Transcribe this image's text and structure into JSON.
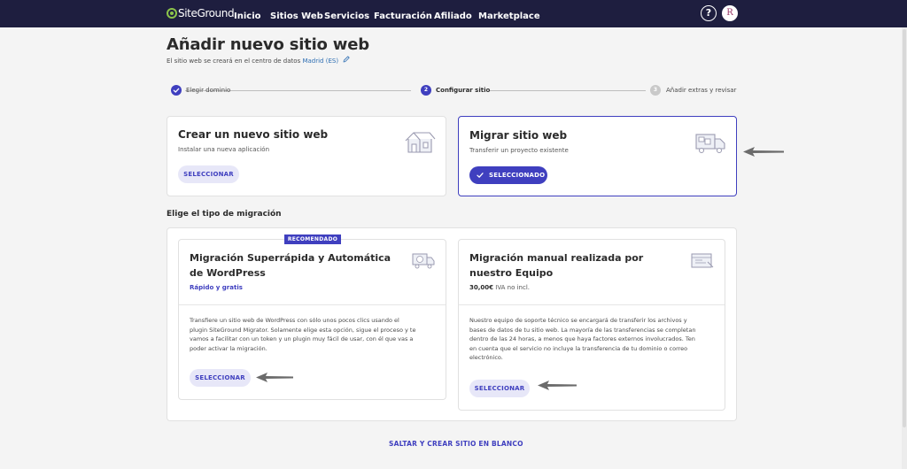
{
  "nav": {
    "logo": "SiteGround",
    "items": [
      "Inicio",
      "Sitios Web",
      "Servicios",
      "Facturación",
      "Afiliado",
      "Marketplace"
    ],
    "help": "?",
    "avatar_initial": "R"
  },
  "header": {
    "title": "Añadir nuevo sitio web",
    "subtitle_prefix": "El sitio web se creará en el centro de datos",
    "datacenter": "Madrid (ES)"
  },
  "steps": [
    {
      "number": "1",
      "label": "Elegir dominio",
      "state": "done"
    },
    {
      "number": "2",
      "label": "Configurar sitio",
      "state": "current"
    },
    {
      "number": "3",
      "label": "Añadir extras y revisar",
      "state": "pending"
    }
  ],
  "cards": {
    "new_site": {
      "title": "Crear un nuevo sitio web",
      "desc": "Instalar una nueva aplicación",
      "button": "SELECCIONAR",
      "icon": "house-icon"
    },
    "migrate": {
      "title": "Migrar sitio web",
      "desc": "Transferir un proyecto existente",
      "button": "SELECCIONADO",
      "icon": "moving-truck-icon"
    }
  },
  "migration": {
    "heading": "Elige el tipo de migración",
    "auto": {
      "badge": "RECOMENDADO",
      "title_line1": "Migración Superrápida y Automática",
      "title_line2": "de WordPress",
      "tagline": "Rápido y gratis",
      "body": [
        "Transfiere un sitio web de WordPress con sólo unos pocos clics usando el",
        "plugin SiteGround Migrator. Solamente elige esta opción, sigue el proceso y te",
        "vamos a facilitar con un token y un plugin muy fácil de usar, con él que vas a",
        "poder activar la migración."
      ],
      "button": "SELECCIONAR"
    },
    "manual": {
      "title_line1": "Migración manual realizada por",
      "title_line2": "nuestro Equipo",
      "price": "30,00€",
      "price_note": "IVA no incl.",
      "body": [
        "Nuestro equipo de soporte técnico se encargará de transferir los archivos y",
        "bases de datos de tu sitio web. La mayoría de las transferencias se completan",
        "dentro de las 24 horas, a menos que haya factores externos involucrados. Ten",
        "en cuenta que el servicio no incluye la transferencia de tu dominio o correo",
        "electrónico."
      ],
      "button": "SELECCIONAR"
    }
  },
  "skip": "SALTAR Y CREAR SITIO EN BLANCO",
  "colors": {
    "nav_bg": "#1e1e3f",
    "accent": "#3f3fbf",
    "button_light_bg": "#e7e7f8",
    "logo_green": "#8bc34a",
    "annotation_arrow": "#6b6b6b"
  }
}
